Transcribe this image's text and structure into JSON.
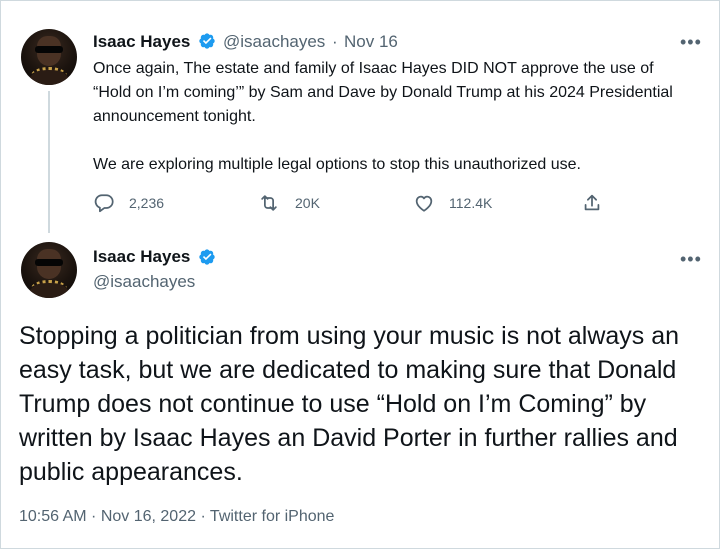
{
  "parent_tweet": {
    "author_name": "Isaac Hayes",
    "author_handle": "@isaachayes",
    "separator": "·",
    "date": "Nov 16",
    "paragraphs": [
      "Once again, The estate and family of Isaac Hayes DID NOT approve the use of “Hold on I’m coming’” by Sam and Dave by Donald Trump at his 2024 Presidential announcement tonight.",
      "We are exploring multiple legal options to stop this unauthorized use."
    ],
    "replies": "2,236",
    "retweets": "20K",
    "likes": "112.4K",
    "more_label": "•••"
  },
  "main_tweet": {
    "author_name": "Isaac Hayes",
    "author_handle": "@isaachayes",
    "text": "Stopping a politician from using your music is not always an easy task, but we are dedicated to making sure that Donald Trump does not continue to use “Hold on I’m Coming” by written by Isaac Hayes an David Porter in further rallies and public appearances.",
    "footer": "10:56 AM · Nov 16, 2022 · Twitter for iPhone",
    "more_label": "•••"
  },
  "icons": {
    "verified": "verified-badge-icon",
    "reply": "reply-icon",
    "retweet": "retweet-icon",
    "like": "heart-icon",
    "share": "share-icon",
    "more": "more-options-icon"
  },
  "colors": {
    "verified_blue": "#1d9bf0",
    "text": "#0f1419",
    "muted": "#536471",
    "border": "#cfd9de"
  }
}
